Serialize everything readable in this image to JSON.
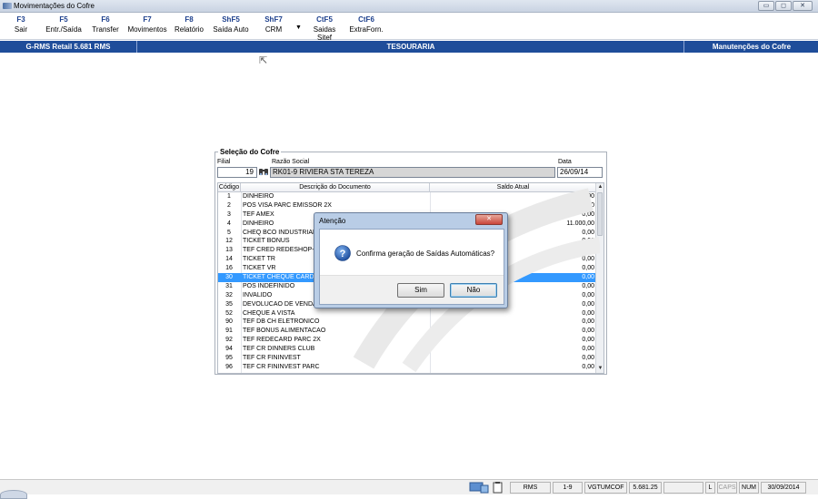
{
  "window": {
    "title": "Movimentações do Cofre",
    "controls": [
      "▭",
      "◻",
      "✕"
    ]
  },
  "toolbar": [
    {
      "key": "F3",
      "label": "Sair"
    },
    {
      "key": "F5",
      "label": "Entr./Saída"
    },
    {
      "key": "F6",
      "label": "Transfer"
    },
    {
      "key": "F7",
      "label": "Movimentos"
    },
    {
      "key": "F8",
      "label": "Relatório"
    },
    {
      "key": "ShF5",
      "label": "Saída Auto"
    },
    {
      "key": "ShF7",
      "label": "CRM"
    },
    {
      "key": "CtF5",
      "label": "Saidas Sitef"
    },
    {
      "key": "CtF6",
      "label": "ExtraForn."
    }
  ],
  "header": {
    "left": "G-RMS Retail 5.681 RMS",
    "center": "TESOURARIA",
    "right": "Manutenções do Cofre"
  },
  "cofre": {
    "title": "Seleção do Cofre",
    "filial_label": "Filial",
    "filial_value": "19",
    "razao_label": "Razão Social",
    "razao_value": "RK01-9 RIVIERA STA TEREZA",
    "data_label": "Data",
    "data_value": "26/09/14",
    "columns": [
      "Código",
      "Descrição do Documento",
      "Saldo Atual"
    ],
    "rows": [
      {
        "code": "1",
        "desc": "DINHEIRO",
        "saldo": "0,00"
      },
      {
        "code": "2",
        "desc": "POS VISA PARC EMISSOR  2X",
        "saldo": "0,00"
      },
      {
        "code": "3",
        "desc": "TEF AMEX",
        "saldo": "0,00"
      },
      {
        "code": "4",
        "desc": "DINHEIRO",
        "saldo": "11.000,00"
      },
      {
        "code": "5",
        "desc": "CHEQ BCO INDUSTRIAL",
        "saldo": "0,00"
      },
      {
        "code": "12",
        "desc": "TICKET BONUS",
        "saldo": "0,00"
      },
      {
        "code": "13",
        "desc": "TEF CRED REDESHOP-C",
        "saldo": "0,00"
      },
      {
        "code": "14",
        "desc": "TICKET TR",
        "saldo": "0,00"
      },
      {
        "code": "16",
        "desc": "TICKET VR",
        "saldo": "0,00"
      },
      {
        "code": "30",
        "desc": "TICKET CHEQUE CARDA",
        "saldo": "0,00",
        "selected": true
      },
      {
        "code": "31",
        "desc": "POS INDEFINIDO",
        "saldo": "0,00"
      },
      {
        "code": "32",
        "desc": "INVALIDO",
        "saldo": "0,00"
      },
      {
        "code": "35",
        "desc": "DEVOLUCAO DE VENDA",
        "saldo": "0,00"
      },
      {
        "code": "52",
        "desc": "CHEQUE A VISTA",
        "saldo": "0,00"
      },
      {
        "code": "90",
        "desc": "TEF DB CH ELETRONICO",
        "saldo": "0,00"
      },
      {
        "code": "91",
        "desc": "TEF BONUS ALIMENTACAO",
        "saldo": "0,00"
      },
      {
        "code": "92",
        "desc": "TEF REDECARD PARC 2X",
        "saldo": "0,00"
      },
      {
        "code": "94",
        "desc": "TEF CR DINNERS CLUB",
        "saldo": "0,00"
      },
      {
        "code": "95",
        "desc": "TEF CR FININVEST",
        "saldo": "0,00"
      },
      {
        "code": "96",
        "desc": "TEF CR FININVEST PARC",
        "saldo": "0,00"
      }
    ]
  },
  "dialog": {
    "title": "Atenção",
    "message": "Confirma geração de Saídas Automáticas?",
    "yes_label": "Sim",
    "no_label": "Não"
  },
  "statusbar": {
    "cells": [
      "RMS",
      "1-9",
      "VGTUMCOF",
      "5.681.25",
      "",
      "L",
      "CAPS",
      "NUM",
      "30/09/2014"
    ]
  }
}
